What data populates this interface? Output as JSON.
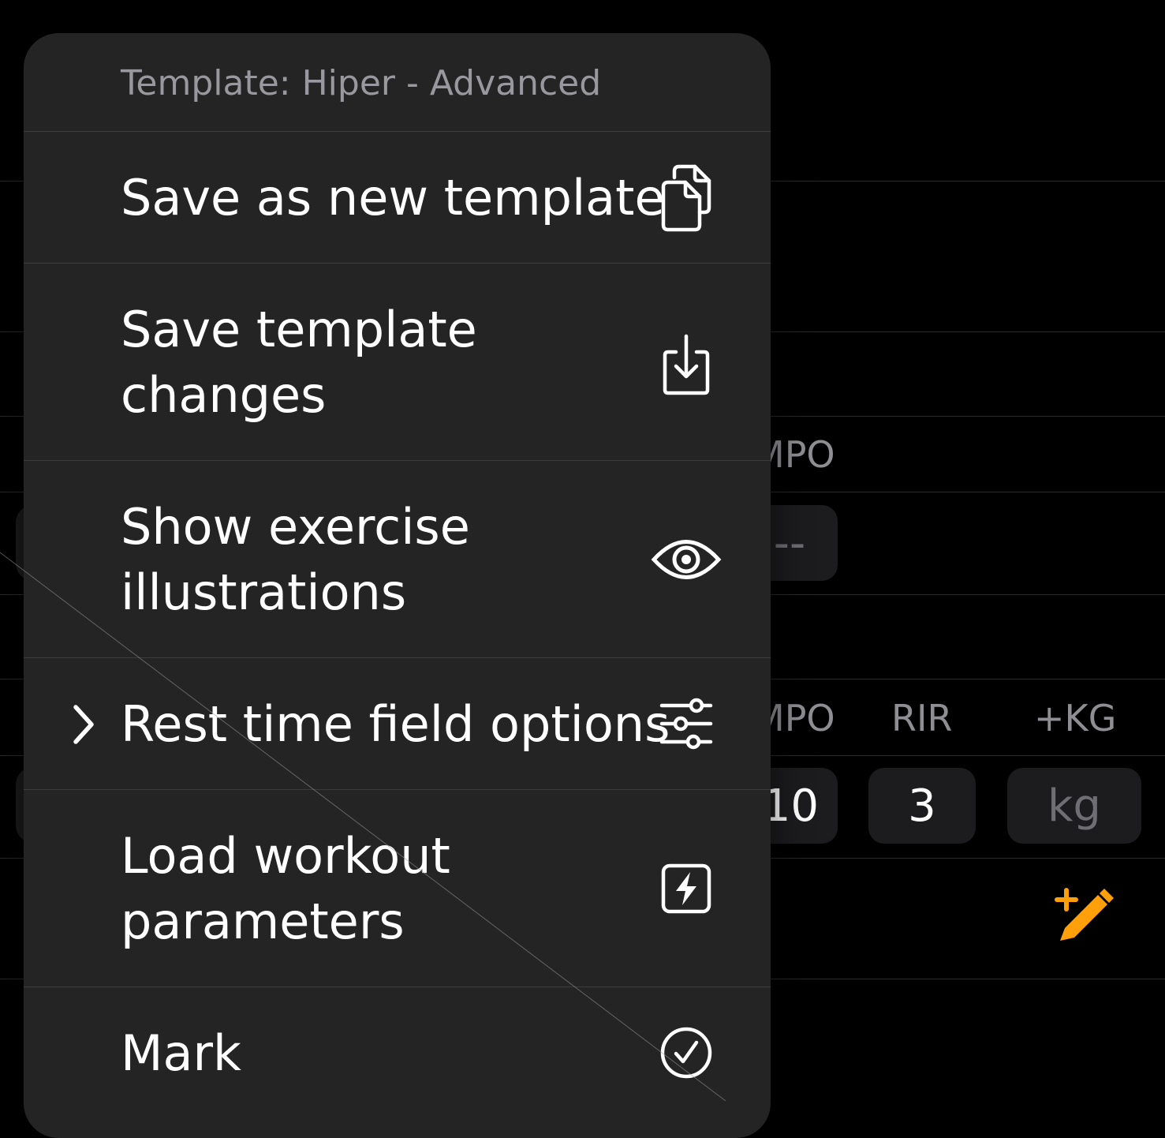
{
  "background": {
    "headers_top": [
      "MPO"
    ],
    "headers_mid": [
      "MPO",
      "RIR",
      "+KG"
    ],
    "row1_value": "--",
    "row2_values": [
      "10",
      "3",
      "kg"
    ]
  },
  "menu": {
    "header": "Template: Hiper - Advanced",
    "items": [
      {
        "line1": "Save as new template",
        "line2": "",
        "icon": "copy-documents-icon"
      },
      {
        "line1": "Save template",
        "line2": "changes",
        "icon": "save-download-icon"
      },
      {
        "line1": "Show exercise",
        "line2": "illustrations",
        "icon": "eye-icon"
      },
      {
        "line1": "Rest time field options",
        "line2": "",
        "icon": "sliders-icon",
        "submenu": true
      },
      {
        "line1": "Load workout",
        "line2": "parameters",
        "icon": "bolt-square-icon"
      },
      {
        "line1": "Mark",
        "line2": "",
        "icon": "checkmark-circle-icon"
      }
    ]
  },
  "colors": {
    "accent": "#ff9f0a",
    "menu_bg": "#242424",
    "separator": "#3c3c3e"
  }
}
